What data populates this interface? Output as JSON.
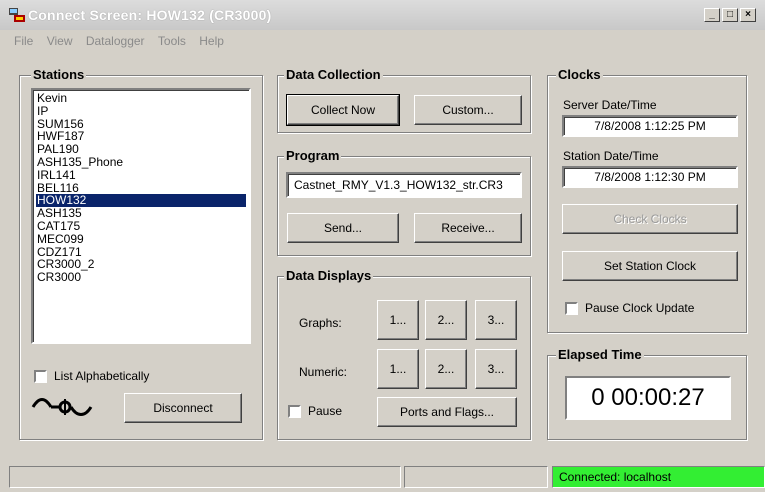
{
  "window": {
    "title": "Connect Screen: HOW132 (CR3000)",
    "min_label": "_",
    "max_label": "□",
    "close_label": "×"
  },
  "menu": [
    "File",
    "View",
    "Datalogger",
    "Tools",
    "Help"
  ],
  "stations": {
    "title": "Stations",
    "items": [
      "Kevin",
      "IP",
      "SUM156",
      "HWF187",
      "PAL190",
      "ASH135_Phone",
      "IRL141",
      "BEL116",
      "HOW132",
      "ASH135",
      "CAT175",
      "MEC099",
      "CDZ171",
      "CR3000_2",
      "CR3000"
    ],
    "selected": "HOW132",
    "list_alpha_label": "List Alphabetically",
    "disconnect_label": "Disconnect"
  },
  "data_collection": {
    "title": "Data Collection",
    "collect_now_label": "Collect Now",
    "custom_label": "Custom..."
  },
  "program": {
    "title": "Program",
    "filename": "Castnet_RMY_V1.3_HOW132_str.CR3",
    "send_label": "Send...",
    "receive_label": "Receive..."
  },
  "data_displays": {
    "title": "Data Displays",
    "graphs_label": "Graphs:",
    "numeric_label": "Numeric:",
    "btn1": "1...",
    "btn2": "2...",
    "btn3": "3...",
    "pause_label": "Pause",
    "ports_flags_label": "Ports and Flags..."
  },
  "clocks": {
    "title": "Clocks",
    "server_label": "Server Date/Time",
    "server_value": "7/8/2008 1:12:25 PM",
    "station_label": "Station Date/Time",
    "station_value": "7/8/2008 1:12:30 PM",
    "check_clocks_label": "Check Clocks",
    "set_clock_label": "Set Station Clock",
    "pause_update_label": "Pause Clock Update"
  },
  "elapsed": {
    "title": "Elapsed Time",
    "value": "0 00:00:27"
  },
  "status": {
    "connection": "Connected: localhost",
    "connected_color": "#33ee33"
  }
}
